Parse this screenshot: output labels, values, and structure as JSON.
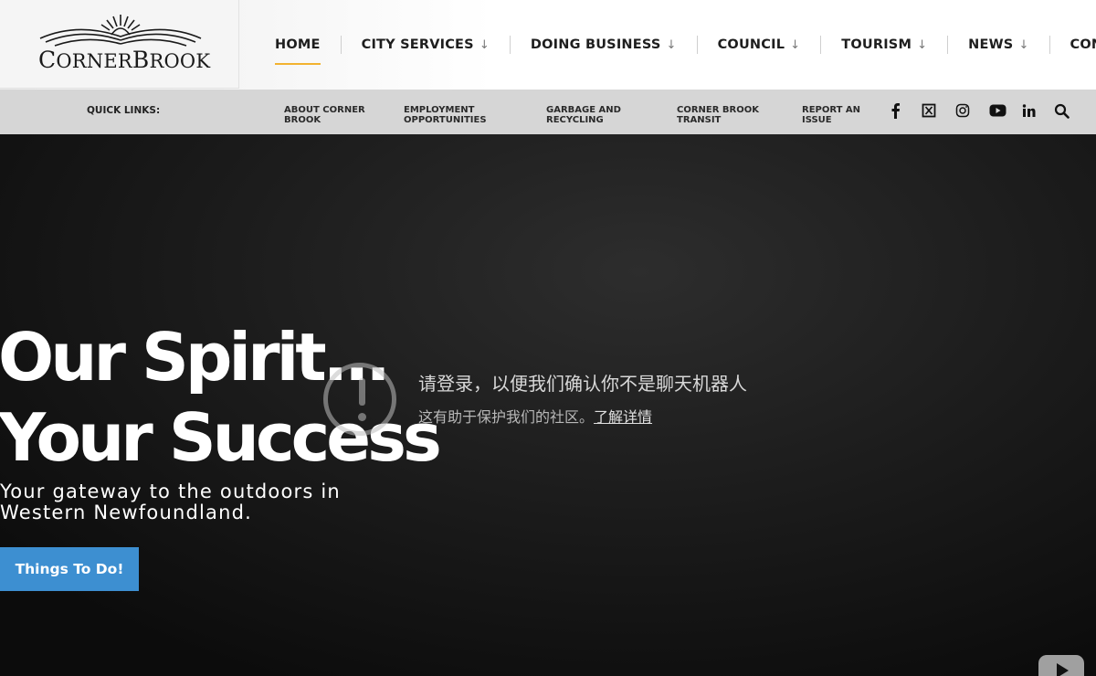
{
  "logo": {
    "text_prefix": "C",
    "text_main": "ORNER",
    "text_mid": "B",
    "text_end": "ROOK"
  },
  "nav": [
    {
      "label": "HOME",
      "has_dropdown": false,
      "active": true
    },
    {
      "label": "CITY SERVICES",
      "has_dropdown": true
    },
    {
      "label": "DOING BUSINESS",
      "has_dropdown": true
    },
    {
      "label": "COUNCIL",
      "has_dropdown": true
    },
    {
      "label": "TOURISM",
      "has_dropdown": true
    },
    {
      "label": "NEWS",
      "has_dropdown": true
    },
    {
      "label": "CONTACT",
      "has_dropdown": false
    }
  ],
  "dropdown_arrow": "↓",
  "quick_links": {
    "label": "QUICK LINKS:",
    "items": [
      {
        "line1": "ABOUT CORNER",
        "line2": "BROOK"
      },
      {
        "line1": "EMPLOYMENT",
        "line2": "OPPORTUNITIES"
      },
      {
        "line1": "GARBAGE AND",
        "line2": "RECYCLING"
      },
      {
        "line1": "CORNER BROOK",
        "line2": "TRANSIT"
      },
      {
        "line1": "REPORT AN",
        "line2": "ISSUE"
      }
    ]
  },
  "social_icons": [
    "facebook-icon",
    "x-twitter-icon",
    "instagram-icon",
    "youtube-icon",
    "linkedin-icon",
    "search-icon"
  ],
  "hero": {
    "title_line1": "Our Spirit...",
    "title_line2": "Your Success",
    "subtitle": "Your gateway to the outdoors in Western Newfoundland.",
    "cta": "Things To Do!"
  },
  "video_overlay": {
    "title": "请登录，以便我们确认你不是聊天机器人",
    "body": "这有助于保护我们的社区。",
    "link": "了解详情"
  },
  "colors": {
    "accent": "#f2b230",
    "cta": "#3d8fd1",
    "quickbar": "#d6d6d6"
  }
}
